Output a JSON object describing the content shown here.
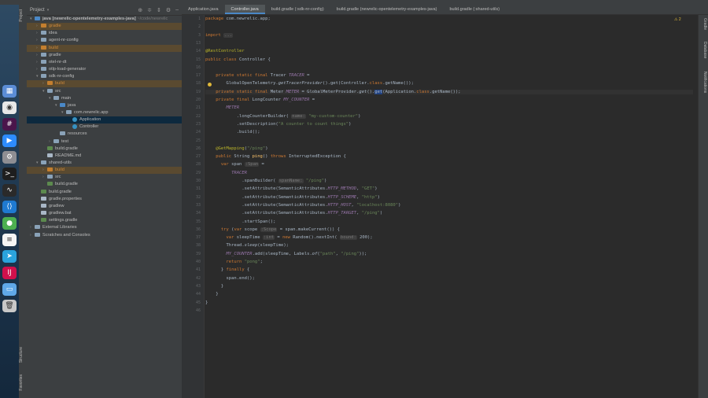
{
  "project_panel": {
    "title": "Project",
    "tree": [
      {
        "label": "java [newrelic-opentelemetry-examples-java]",
        "suffix": " ~/code/newrelic",
        "indent": 0,
        "arrow": "▾",
        "icon": "folder-b",
        "state": ""
      },
      {
        "label": "gradle",
        "indent": 1,
        "arrow": "›",
        "icon": "folder-o",
        "state": "excluded"
      },
      {
        "label": "idea",
        "indent": 1,
        "arrow": "›",
        "icon": "folder",
        "state": ""
      },
      {
        "label": "agent-nr-config",
        "indent": 1,
        "arrow": "›",
        "icon": "folder",
        "state": ""
      },
      {
        "label": "build",
        "indent": 1,
        "arrow": "›",
        "icon": "folder-o",
        "state": "excluded"
      },
      {
        "label": "gradle",
        "indent": 1,
        "arrow": "›",
        "icon": "folder",
        "state": ""
      },
      {
        "label": "otel-nr-dt",
        "indent": 1,
        "arrow": "›",
        "icon": "folder",
        "state": ""
      },
      {
        "label": "otlp-load-generator",
        "indent": 1,
        "arrow": "›",
        "icon": "folder",
        "state": ""
      },
      {
        "label": "sdk-nr-config",
        "indent": 1,
        "arrow": "▾",
        "icon": "folder",
        "state": ""
      },
      {
        "label": "build",
        "indent": 2,
        "arrow": "›",
        "icon": "folder-o",
        "state": "excluded"
      },
      {
        "label": "src",
        "indent": 2,
        "arrow": "▾",
        "icon": "folder",
        "state": ""
      },
      {
        "label": "main",
        "indent": 3,
        "arrow": "▾",
        "icon": "folder",
        "state": ""
      },
      {
        "label": "java",
        "indent": 4,
        "arrow": "▾",
        "icon": "folder-b",
        "state": ""
      },
      {
        "label": "com.newrelic.app",
        "indent": 5,
        "arrow": "▾",
        "icon": "folder",
        "state": ""
      },
      {
        "label": "Application",
        "indent": 6,
        "arrow": "",
        "icon": "class-i",
        "state": "selected"
      },
      {
        "label": "Controller",
        "indent": 6,
        "arrow": "",
        "icon": "class-i",
        "state": ""
      },
      {
        "label": "resources",
        "indent": 4,
        "arrow": "",
        "icon": "folder",
        "state": ""
      },
      {
        "label": "test",
        "indent": 3,
        "arrow": "›",
        "icon": "folder",
        "state": ""
      },
      {
        "label": "build.gradle",
        "indent": 2,
        "arrow": "",
        "icon": "file-g",
        "state": ""
      },
      {
        "label": "README.md",
        "indent": 2,
        "arrow": "",
        "icon": "file-t",
        "state": ""
      },
      {
        "label": "shared-utils",
        "indent": 1,
        "arrow": "▾",
        "icon": "folder",
        "state": ""
      },
      {
        "label": "build",
        "indent": 2,
        "arrow": "›",
        "icon": "folder-o",
        "state": "excluded"
      },
      {
        "label": "src",
        "indent": 2,
        "arrow": "›",
        "icon": "folder",
        "state": ""
      },
      {
        "label": "build.gradle",
        "indent": 2,
        "arrow": "",
        "icon": "file-g",
        "state": ""
      },
      {
        "label": "build.gradle",
        "indent": 1,
        "arrow": "",
        "icon": "file-g",
        "state": ""
      },
      {
        "label": "gradle.properties",
        "indent": 1,
        "arrow": "",
        "icon": "file-t",
        "state": ""
      },
      {
        "label": "gradlew",
        "indent": 1,
        "arrow": "",
        "icon": "file-t",
        "state": ""
      },
      {
        "label": "gradlew.bat",
        "indent": 1,
        "arrow": "",
        "icon": "file-t",
        "state": ""
      },
      {
        "label": "settings.gradle",
        "indent": 1,
        "arrow": "",
        "icon": "file-g",
        "state": ""
      },
      {
        "label": "External Libraries",
        "indent": 0,
        "arrow": "›",
        "icon": "folder",
        "state": ""
      },
      {
        "label": "Scratches and Consoles",
        "indent": 0,
        "arrow": "›",
        "icon": "folder",
        "state": ""
      }
    ]
  },
  "left_strip": {
    "project": "Project",
    "structure": "Structure",
    "favorites": "Favorites"
  },
  "right_strip": {
    "gradle": "Gradle",
    "database": "Database",
    "notifications": "Notifications"
  },
  "tabs": [
    {
      "label": "Application.java",
      "active": false
    },
    {
      "label": "Controller.java",
      "active": true
    },
    {
      "label": "build.gradle (:sdk-nr-config)",
      "active": false
    },
    {
      "label": "build.gradle (newrelic-opentelemetry-examples-java)",
      "active": false
    },
    {
      "label": "build.gradle (:shared-utils)",
      "active": false
    }
  ],
  "warnings": "⚠ 2",
  "current_line": 9,
  "code": [
    {
      "n": 1,
      "html": "<span class='kw'>package</span> com.newrelic.app;"
    },
    {
      "n": 2,
      "html": ""
    },
    {
      "n": 3,
      "html": "<span class='kw'>import</span> <span class='hint'>...</span>"
    },
    {
      "n": 13,
      "html": ""
    },
    {
      "n": 14,
      "html": "<span class='an'>@RestController</span>"
    },
    {
      "n": 15,
      "html": "<span class='kw'>public class</span> Controller {"
    },
    {
      "n": 16,
      "html": ""
    },
    {
      "n": 17,
      "html": "    <span class='kw'>private static final</span> Tracer <span class='cst'>TRACER</span> ="
    },
    {
      "n": 18,
      "html": "        GlobalOpenTelemetry.<i>getTracerProvider</i>().get(Controller.<span class='kw'>class</span>.getName());"
    },
    {
      "n": 19,
      "html": "    <span class='kw'>private static final</span> Meter <span class='cst'>METER</span> = GlobalMeterProvider.<i>get</i>().<span class='cursor-hl'>get</span>(Application.<span class='kw'>class</span>.getName());"
    },
    {
      "n": 20,
      "html": "    <span class='kw'>private final</span> LongCounter <span class='cst'>MY_COUNTER</span> ="
    },
    {
      "n": 21,
      "html": "        <span class='cst'>METER</span>"
    },
    {
      "n": 22,
      "html": "            .longCounterBuilder( <span class='hint'>name:</span> <span class='st'>\"my-custom-counter\"</span>)"
    },
    {
      "n": 23,
      "html": "            .setDescription(<span class='st'>\"A counter to count things\"</span>)"
    },
    {
      "n": 24,
      "html": "            .build();"
    },
    {
      "n": 25,
      "html": ""
    },
    {
      "n": 26,
      "html": "    <span class='an'>@GetMapping</span>(<span class='st'>\"/ping\"</span>)"
    },
    {
      "n": 27,
      "html": "    <span class='kw'>public</span> String <span class='fn'>ping</span>() <span class='kw'>throws</span> InterruptedException {"
    },
    {
      "n": 28,
      "html": "      <span class='kw'>var</span> span <span class='hint'>:Span</span> ="
    },
    {
      "n": 29,
      "html": "          <span class='cst'>TRACER</span>"
    },
    {
      "n": 30,
      "html": "              .spanBuilder( <span class='hint'>spanName:</span> <span class='st'>\"/ping\"</span>)"
    },
    {
      "n": 31,
      "html": "              .setAttribute(SemanticAttributes.<span class='cst'>HTTP_METHOD</span>, <span class='st'>\"GET\"</span>)"
    },
    {
      "n": 32,
      "html": "              .setAttribute(SemanticAttributes.<span class='cst'>HTTP_SCHEME</span>, <span class='st'>\"http\"</span>)"
    },
    {
      "n": 33,
      "html": "              .setAttribute(SemanticAttributes.<span class='cst'>HTTP_HOST</span>, <span class='st'>\"localhost:8080\"</span>)"
    },
    {
      "n": 34,
      "html": "              .setAttribute(SemanticAttributes.<span class='cst'>HTTP_TARGET</span>, <span class='st'>\"/ping\"</span>)"
    },
    {
      "n": 35,
      "html": "              .startSpan();"
    },
    {
      "n": 36,
      "html": "      <span class='kw'>try</span> (<span class='kw'>var</span> scope <span class='hint'>:Scope</span> = span.makeCurrent()) {"
    },
    {
      "n": 37,
      "html": "        <span class='kw'>var</span> sleepTime <span class='hint'>:int</span> = <span class='kw'>new</span> Random().nextInt( <span class='hint'>bound:</span> 200);"
    },
    {
      "n": 38,
      "html": "        Thread.<i>sleep</i>(sleepTime);"
    },
    {
      "n": 39,
      "html": "        <span class='cst'>MY_COUNTER</span>.add(sleepTime, Labels.<i>of</i>(<span class='st'>\"path\"</span>, <span class='st'>\"/ping\"</span>));"
    },
    {
      "n": 40,
      "html": "        <span class='kw'>return</span> <span class='st'>\"pong\"</span>;"
    },
    {
      "n": 41,
      "html": "      } <span class='kw'>finally</span> {"
    },
    {
      "n": 42,
      "html": "        span.end();"
    },
    {
      "n": 43,
      "html": "      }"
    },
    {
      "n": 44,
      "html": "    }"
    },
    {
      "n": 45,
      "html": "}"
    },
    {
      "n": 46,
      "html": ""
    }
  ],
  "dock": [
    {
      "name": "launchpad-icon",
      "color": "#5b8dd6",
      "glyph": "▦"
    },
    {
      "name": "chrome-icon",
      "color": "#e8e8e8",
      "glyph": "◉"
    },
    {
      "name": "slack-icon",
      "color": "#4a154b",
      "glyph": "#"
    },
    {
      "name": "zoom-icon",
      "color": "#2d8cff",
      "glyph": "▶"
    },
    {
      "name": "system-preferences-icon",
      "color": "#8e8e93",
      "glyph": "⚙"
    },
    {
      "name": "terminal-icon",
      "color": "#1e1e1e",
      "glyph": ">_"
    },
    {
      "name": "activity-monitor-icon",
      "color": "#2a2a2a",
      "glyph": "∿"
    },
    {
      "name": "vscode-icon",
      "color": "#1f7ad1",
      "glyph": "⟨⟩"
    },
    {
      "name": "app-green-icon",
      "color": "#4caf50",
      "glyph": "●"
    },
    {
      "name": "notes-icon",
      "color": "#f5f5f5",
      "glyph": "≡"
    },
    {
      "name": "telegram-icon",
      "color": "#2aa3dd",
      "glyph": "➤"
    },
    {
      "name": "intellij-icon",
      "color": "#d0104c",
      "glyph": "IJ"
    },
    {
      "name": "finder-folder-icon",
      "color": "#5fa8e8",
      "glyph": "▭"
    },
    {
      "name": "trash-icon",
      "color": "#c8c8c8",
      "glyph": "🗑"
    }
  ]
}
